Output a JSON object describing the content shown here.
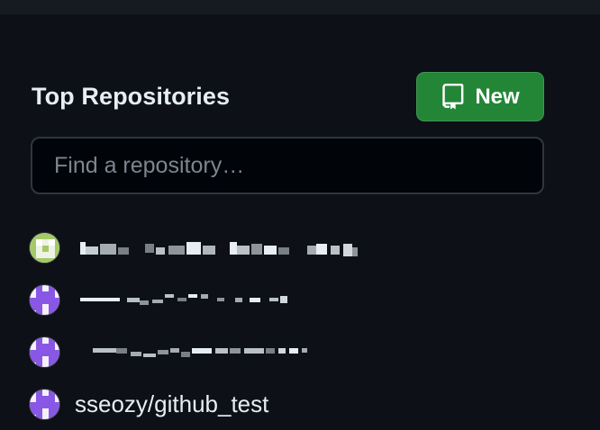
{
  "section": {
    "title": "Top Repositories"
  },
  "new_button": {
    "label": "New",
    "icon": "repo-icon",
    "color": "#238636"
  },
  "search": {
    "placeholder": "Find a repository…",
    "value": ""
  },
  "repositories": [
    {
      "name": "",
      "redacted": true,
      "avatar": "green-identicon"
    },
    {
      "name": "",
      "redacted": true,
      "avatar": "purple-identicon"
    },
    {
      "name": "",
      "redacted": true,
      "avatar": "purple-identicon"
    },
    {
      "name": "sseozy/github_test",
      "redacted": false,
      "avatar": "purple-identicon"
    }
  ],
  "colors": {
    "background": "#0d1117",
    "text": "#e6edf3",
    "muted": "#7d8590",
    "border": "#30363d",
    "identicon_purple": "#8957e5",
    "identicon_green": "#a5c96a"
  }
}
